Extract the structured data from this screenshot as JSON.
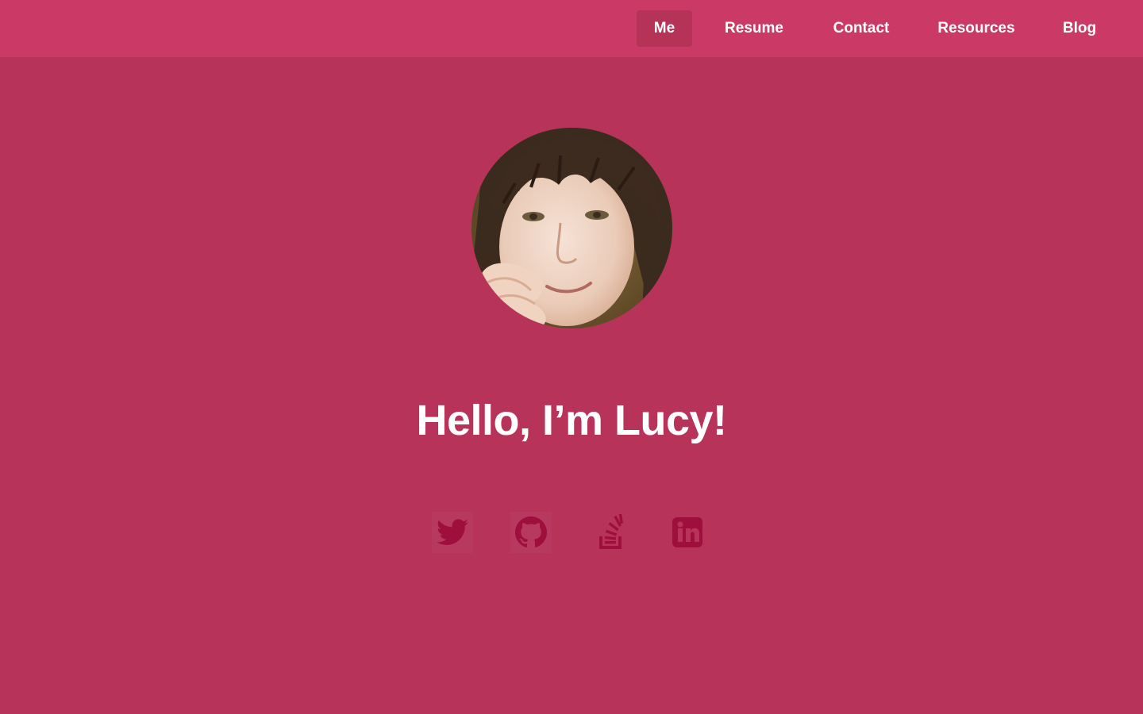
{
  "colors": {
    "page_background": "#b73359",
    "navbar_background": "#cb3a66",
    "active_nav_background": "#b63358",
    "icon_color": "#9e0f3e",
    "text_color": "#ffffff"
  },
  "nav": {
    "items": [
      {
        "label": "Me",
        "active": true
      },
      {
        "label": "Resume",
        "active": false
      },
      {
        "label": "Contact",
        "active": false
      },
      {
        "label": "Resources",
        "active": false
      },
      {
        "label": "Blog",
        "active": false
      }
    ]
  },
  "hero": {
    "greeting": "Hello, I’m Lucy!"
  },
  "social": {
    "icons": [
      "twitter-icon",
      "github-icon",
      "stackoverflow-icon",
      "linkedin-icon"
    ]
  }
}
